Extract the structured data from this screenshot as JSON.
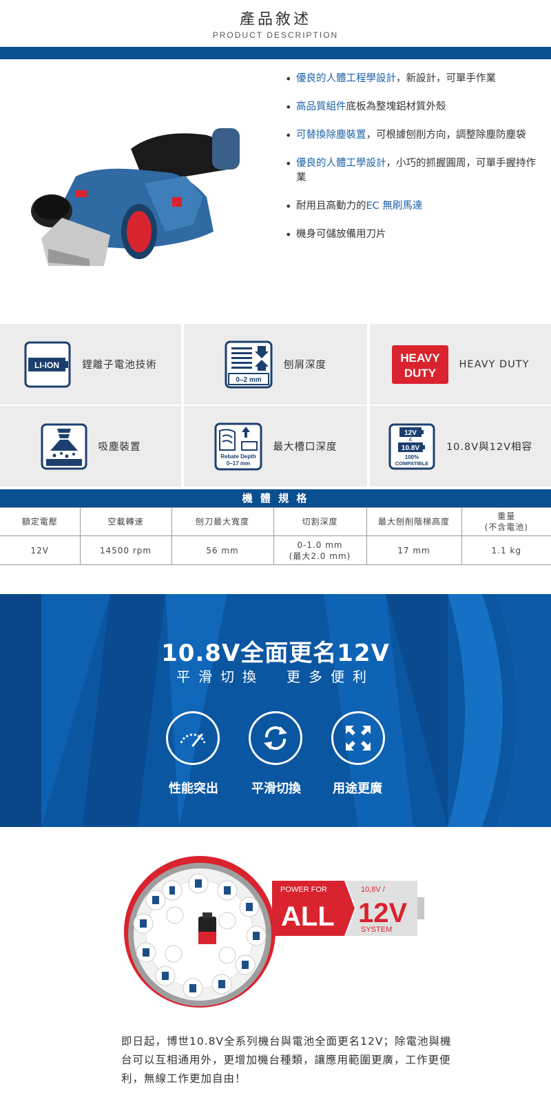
{
  "header": {
    "title": "產品敘述",
    "subtitle": "PRODUCT DESCRIPTION"
  },
  "features": [
    {
      "highlight": "優良的人體工程學設計",
      "text": "，新設計，可單手作業"
    },
    {
      "highlight": "高品質組件",
      "text": "底板為整塊鋁材質外殼"
    },
    {
      "highlight": "可替換除塵裝置",
      "text": "，可根據刨削方向，調整除塵防塵袋"
    },
    {
      "highlight": "優良的人體工學設計",
      "text": "，小巧的抓握圓周，可單手握持作業"
    },
    {
      "prefix": "耐用且高動力的",
      "highlight": "EC 無刷馬達",
      "text": ""
    },
    {
      "highlight": "",
      "text": "機身可儲放備用刀片"
    }
  ],
  "icons": {
    "liion": {
      "badge": "LI-ION",
      "label": "鋰離子電池技術"
    },
    "depth": {
      "badge": "0–2 mm",
      "label": "刨屑深度"
    },
    "heavy": {
      "line1": "HEAVY",
      "line2": "DUTY",
      "label": "HEAVY DUTY"
    },
    "dust": {
      "label": "吸塵裝置"
    },
    "rebate": {
      "line1": "Rebate Depth",
      "line2": "0–17 mm",
      "label": "最大槽口深度"
    },
    "compat": {
      "v1": "12V",
      "amp": "&",
      "v2": "10.8V",
      "pct": "100%",
      "word": "COMPATIBLE",
      "label": "10.8V與12V相容"
    }
  },
  "spec": {
    "title": "機 體 規 格",
    "headers": [
      "額定電壓",
      "空載轉速",
      "刨刀最大寬度",
      "切割深度",
      "最大刨削階梯高度",
      "重量"
    ],
    "header_note": "(不含電池)",
    "values": [
      "12V",
      "14500 rpm",
      "56 mm",
      "0-1.0 mm",
      "17 mm",
      "1.1 kg"
    ],
    "value_note": "(最大2.0 mm)"
  },
  "banner": {
    "headline": "10.8V全面更名12V",
    "subline": "平滑切換　更多便利",
    "items": [
      {
        "label": "性能突出",
        "icon": "speedometer-icon"
      },
      {
        "label": "平滑切換",
        "icon": "refresh-icon"
      },
      {
        "label": "用途更廣",
        "icon": "expand-icon"
      }
    ]
  },
  "pfa": {
    "power_for": "POWER FOR",
    "all": "ALL",
    "volt_small": "10,8V /",
    "volt_big": "12V",
    "system": "SYSTEM"
  },
  "description": "即日起，博世10.8V全系列機台與電池全面更名12V；除電池與機台可以互相通用外，更增加機台種類，讓應用範圍更廣，工作更便利，無線工作更加自由！",
  "colors": {
    "brand_blue": "#0a4f8f",
    "bosch_red": "#d9232e",
    "text_blue": "#1b62a8"
  }
}
